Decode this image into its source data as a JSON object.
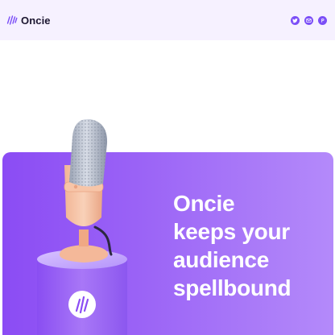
{
  "header": {
    "brand_name": "Oncie",
    "social": [
      {
        "icon": "twitter-icon",
        "label": "Twitter"
      },
      {
        "icon": "mail-icon",
        "label": "Email"
      },
      {
        "icon": "producthunt-icon",
        "label": "Product Hunt"
      }
    ]
  },
  "hero": {
    "headline_lines": [
      "Oncie",
      "keeps your",
      "audience",
      "spellbound"
    ]
  },
  "colors": {
    "accent": "#7b4ef7",
    "hero_start": "#8b4cf4",
    "hero_end": "#b48afa",
    "header_bg": "#f6f1ff",
    "mic_body": "#f6c3a3"
  }
}
